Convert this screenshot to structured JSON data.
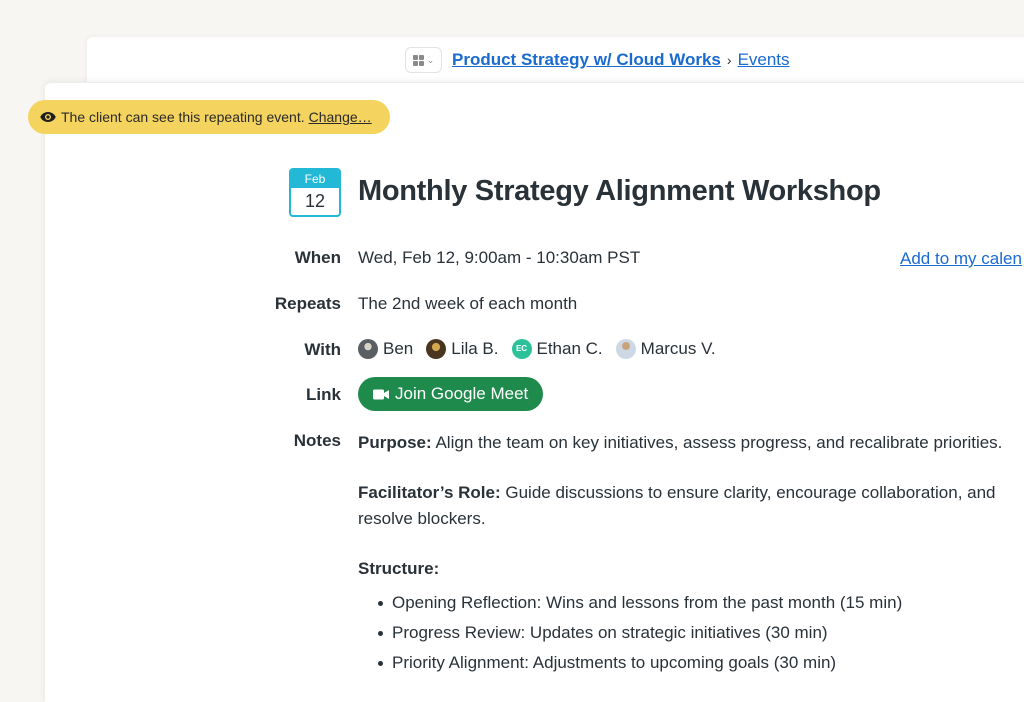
{
  "breadcrumb": {
    "project_switcher_icon": "grid-icon",
    "project": "Product Strategy w/ Cloud Works",
    "separator": "›",
    "section": "Events"
  },
  "visibility_notice": {
    "icon": "eye-icon",
    "text": "The client can see this repeating event.",
    "action": "Change…",
    "color": "#f4d35e"
  },
  "event": {
    "date_badge": {
      "month": "Feb",
      "day": "12",
      "color": "#22b8d6"
    },
    "title": "Monthly Strategy Alignment Workshop",
    "add_to_calendar": "Add to my calen",
    "rows": {
      "when": {
        "label": "When",
        "value": "Wed, Feb 12, 9:00am - 10:30am PST"
      },
      "repeats": {
        "label": "Repeats",
        "value": "The 2nd week of each month"
      },
      "with": {
        "label": "With",
        "attendees": [
          {
            "name": "Ben",
            "avatar": "photo"
          },
          {
            "name": "Lila B.",
            "avatar": "photo"
          },
          {
            "name": "Ethan C.",
            "avatar": "initials",
            "initials": "EC",
            "color": "#2bc29a"
          },
          {
            "name": "Marcus V.",
            "avatar": "photo"
          }
        ]
      },
      "link": {
        "label": "Link",
        "button": "Join Google Meet",
        "icon": "video-camera-icon",
        "color": "#1e8a4c"
      },
      "notes": {
        "label": "Notes",
        "purpose_label": "Purpose:",
        "purpose_text": " Align the team on key initiatives, assess progress, and recalibrate priorities.",
        "facilitator_label": "Facilitator’s Role:",
        "facilitator_text": " Guide discussions to ensure clarity, encourage collaboration, and resolve blockers.",
        "structure_label": "Structure:",
        "structure_items": [
          "Opening Reflection: Wins and lessons from the past month (15 min)",
          "Progress Review: Updates on strategic initiatives (30 min)",
          "Priority Alignment: Adjustments to upcoming goals (30 min)"
        ]
      }
    }
  }
}
